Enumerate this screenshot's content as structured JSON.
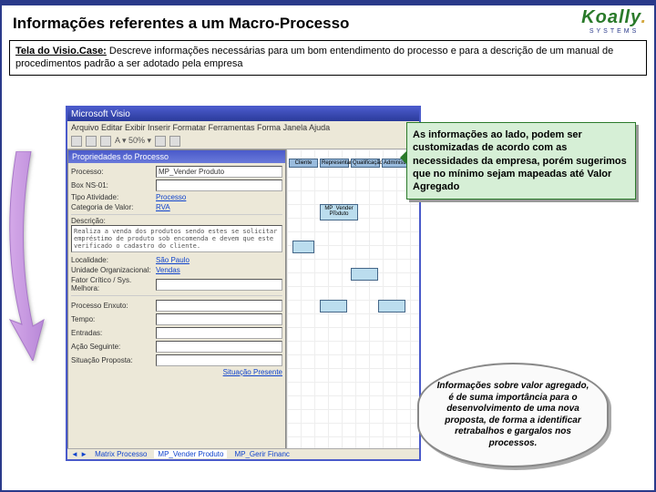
{
  "logo": {
    "name": "Koally",
    "sub": "SYSTEMS"
  },
  "title": "Informações referentes a um Macro-Processo",
  "description": {
    "bold": "Tela do Visio.Case:",
    "text": " Descreve informações necessárias para um bom entendimento do processo e para a descrição de um manual de procedimentos padrão a ser adotado pela  empresa"
  },
  "callout1": "As informações ao lado, podem ser customizadas de acordo com as necessidades da empresa, porém sugerimos que no mínimo sejam mapeadas até Valor Agregado",
  "callout2": "Informações sobre valor agregado, é de suma importância para o desenvolvimento de uma nova proposta, de forma a identificar retrabalhos e gargalos nos processos.",
  "visio": {
    "title": "Propriedades do Processo",
    "menu": "Arquivo  Editar  Exibir  Inserir  Formatar  Ferramentas  Forma  Janela  Ajuda",
    "toolbar": "A ▾  50%  ▾",
    "dlg": {
      "header": "Propriedades do Processo",
      "field_process": {
        "label": "Processo:",
        "value": "MP_Vender Produto"
      },
      "field_who": {
        "label": "Box NS-01:",
        "value": ""
      },
      "field_type": {
        "label": "Tipo Atividade:",
        "value": "Processo"
      },
      "field_cat": {
        "label": "Categoria de Valor:",
        "value": "RVA"
      },
      "field_desc_label": "Descrição:",
      "field_desc_val": "Realiza a venda dos produtos sendo estes se solicitar empréstimo de produto sob encomenda e devem que este verificado o cadastro do cliente.",
      "field_local": {
        "label": "Localidade:",
        "value": "São Paulo"
      },
      "field_org": {
        "label": "Unidade Organizacional:",
        "value": "Vendas"
      },
      "field_fc": {
        "label": "Fator Crítico / Sys. Melhora:",
        "value": ""
      },
      "field_pe": {
        "label": "Processo Enxuto:",
        "value": ""
      },
      "field_tempo": {
        "label": "Tempo:",
        "value": ""
      },
      "field_entrada": {
        "label": "Entradas:",
        "value": ""
      },
      "field_saida": {
        "label": "Ação Seguinte:",
        "value": ""
      },
      "field_sit": {
        "label": "Situação Proposta:",
        "value": ""
      },
      "status": "Situação Presente"
    },
    "tabs": {
      "t1": "Matrix Processo",
      "t2": "MP_Vender Produto",
      "t3": "MP_Gerir Financ"
    },
    "canvas": {
      "h1": "Cliente",
      "h2": "Representante",
      "h3": "Qualificação",
      "h4": "Administrativo",
      "b1": "MP_Vender Produto"
    }
  }
}
